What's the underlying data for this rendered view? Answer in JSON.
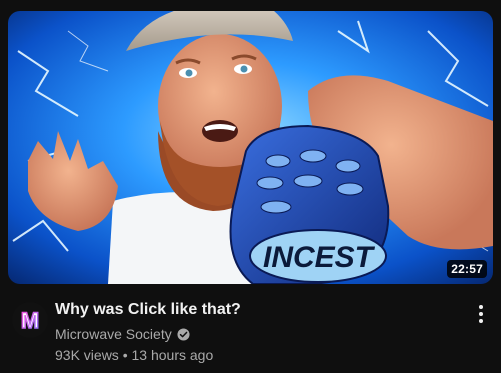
{
  "video": {
    "title": "Why was Click like that?",
    "duration": "22:57",
    "views": "93K views",
    "separator": "•",
    "age": "13 hours ago",
    "thumbnail_text": "INCEST"
  },
  "channel": {
    "name": "Microwave Society",
    "avatar_letter": "M",
    "verified": true
  },
  "icons": {
    "verified": "verified-check-icon",
    "menu": "more-vert-icon"
  },
  "colors": {
    "background": "#0f0f0f",
    "title": "#f1f1f1",
    "secondary": "#aaaaaa",
    "thumbnail_blue": "#1e88ff",
    "remote_blue": "#1b49b8"
  }
}
